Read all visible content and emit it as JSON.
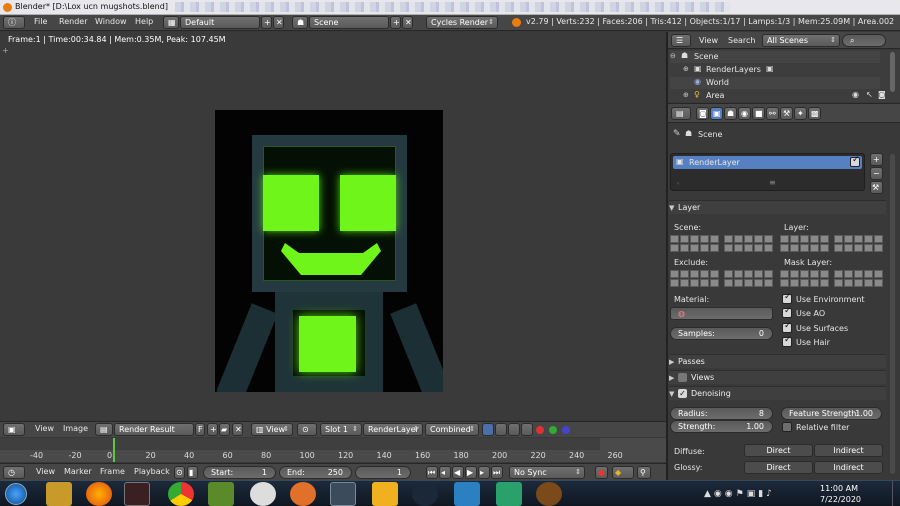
{
  "titlebar": {
    "title": "Blender* [D:\\Lox ucn mugshots.blend]"
  },
  "top_header": {
    "menus": [
      "File",
      "Render",
      "Window",
      "Help"
    ],
    "screen_layout": "Default",
    "scene": "Scene",
    "engine": "Cycles Render",
    "stats": "v2.79 | Verts:232 | Faces:206 | Tris:412 | Objects:1/17 | Lamps:1/3 | Mem:25.09M | Area.002"
  },
  "viewport": {
    "frame_info": "Frame:1 | Time:00:34.84 | Mem:0.35M, Peak: 107.45M"
  },
  "outliner": {
    "view_label": "View",
    "search_label": "Search",
    "filter": "All Scenes",
    "items": [
      {
        "label": "Scene"
      },
      {
        "label": "RenderLayers"
      },
      {
        "label": "World"
      },
      {
        "label": "Area"
      }
    ]
  },
  "properties": {
    "context_label": "Scene",
    "render_layer": "RenderLayer",
    "layer_panel": {
      "title": "Layer",
      "scene_label": "Scene:",
      "layer_label": "Layer:",
      "exclude_label": "Exclude:",
      "mask_label": "Mask Layer:",
      "material_label": "Material:",
      "samples_label": "Samples:",
      "samples_value": "0",
      "options": [
        "Use Environment",
        "Use AO",
        "Use Surfaces",
        "Use Hair"
      ]
    },
    "passes_title": "Passes",
    "views_title": "Views",
    "denoising_title": "Denoising",
    "denoise": {
      "radius_label": "Radius:",
      "radius_value": "8",
      "strength_label": "Strength:",
      "strength_value": "1.00",
      "feature_label": "Feature Strength:",
      "feature_value": "1.00",
      "relative_label": "Relative filter"
    },
    "diffuse_label": "Diffuse:",
    "glossy_label": "Glossy:",
    "direct_label": "Direct",
    "indirect_label": "Indirect"
  },
  "image_header": {
    "view": "View",
    "image": "Image",
    "image_name": "Render Result",
    "f_label": "F",
    "view_mode": "View",
    "slot": "Slot 1",
    "layer": "RenderLayer",
    "pass": "Combined"
  },
  "timeline": {
    "ticks": [
      "-40",
      "-20",
      "0",
      "20",
      "40",
      "60",
      "80",
      "100",
      "120",
      "140",
      "160",
      "180",
      "200",
      "220",
      "240",
      "260"
    ]
  },
  "timeline_header": {
    "view": "View",
    "marker": "Marker",
    "frame": "Frame",
    "playback": "Playback",
    "start_label": "Start:",
    "start_value": "1",
    "end_label": "End:",
    "end_value": "250",
    "current": "1",
    "sync": "No Sync"
  },
  "taskbar": {
    "time": "11:00 AM",
    "date": "7/22/2020"
  }
}
